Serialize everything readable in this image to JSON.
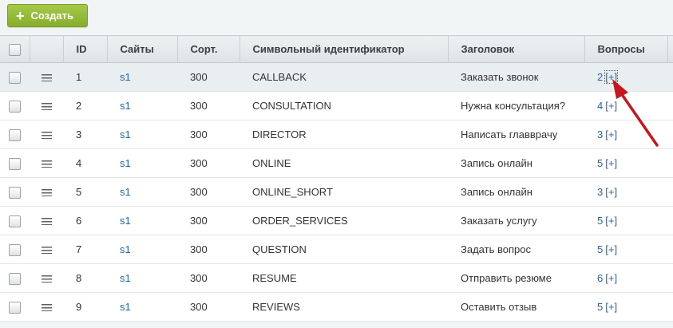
{
  "toolbar": {
    "create_label": "Создать"
  },
  "table": {
    "headers": {
      "id": "ID",
      "sites": "Сайты",
      "sort": "Сорт.",
      "code": "Символьный идентификатор",
      "title": "Заголовок",
      "questions": "Вопросы"
    },
    "rows": [
      {
        "id": "1",
        "site": "s1",
        "sort": "300",
        "code": "CALLBACK",
        "title": "Заказать звонок",
        "questions": "2",
        "add": "[+]"
      },
      {
        "id": "2",
        "site": "s1",
        "sort": "300",
        "code": "CONSULTATION",
        "title": "Нужна консультация?",
        "questions": "4",
        "add": "[+]"
      },
      {
        "id": "3",
        "site": "s1",
        "sort": "300",
        "code": "DIRECTOR",
        "title": "Написать главврачу",
        "questions": "3",
        "add": "[+]"
      },
      {
        "id": "4",
        "site": "s1",
        "sort": "300",
        "code": "ONLINE",
        "title": "Запись онлайн",
        "questions": "5",
        "add": "[+]"
      },
      {
        "id": "5",
        "site": "s1",
        "sort": "300",
        "code": "ONLINE_SHORT",
        "title": "Запись онлайн",
        "questions": "3",
        "add": "[+]"
      },
      {
        "id": "6",
        "site": "s1",
        "sort": "300",
        "code": "ORDER_SERVICES",
        "title": "Заказать услугу",
        "questions": "5",
        "add": "[+]"
      },
      {
        "id": "7",
        "site": "s1",
        "sort": "300",
        "code": "QUESTION",
        "title": "Задать вопрос",
        "questions": "5",
        "add": "[+]"
      },
      {
        "id": "8",
        "site": "s1",
        "sort": "300",
        "code": "RESUME",
        "title": "Отправить резюме",
        "questions": "6",
        "add": "[+]"
      },
      {
        "id": "9",
        "site": "s1",
        "sort": "300",
        "code": "REVIEWS",
        "title": "Оставить отзыв",
        "questions": "5",
        "add": "[+]"
      }
    ]
  },
  "annotation": {
    "arrow_color": "#c8161d"
  }
}
